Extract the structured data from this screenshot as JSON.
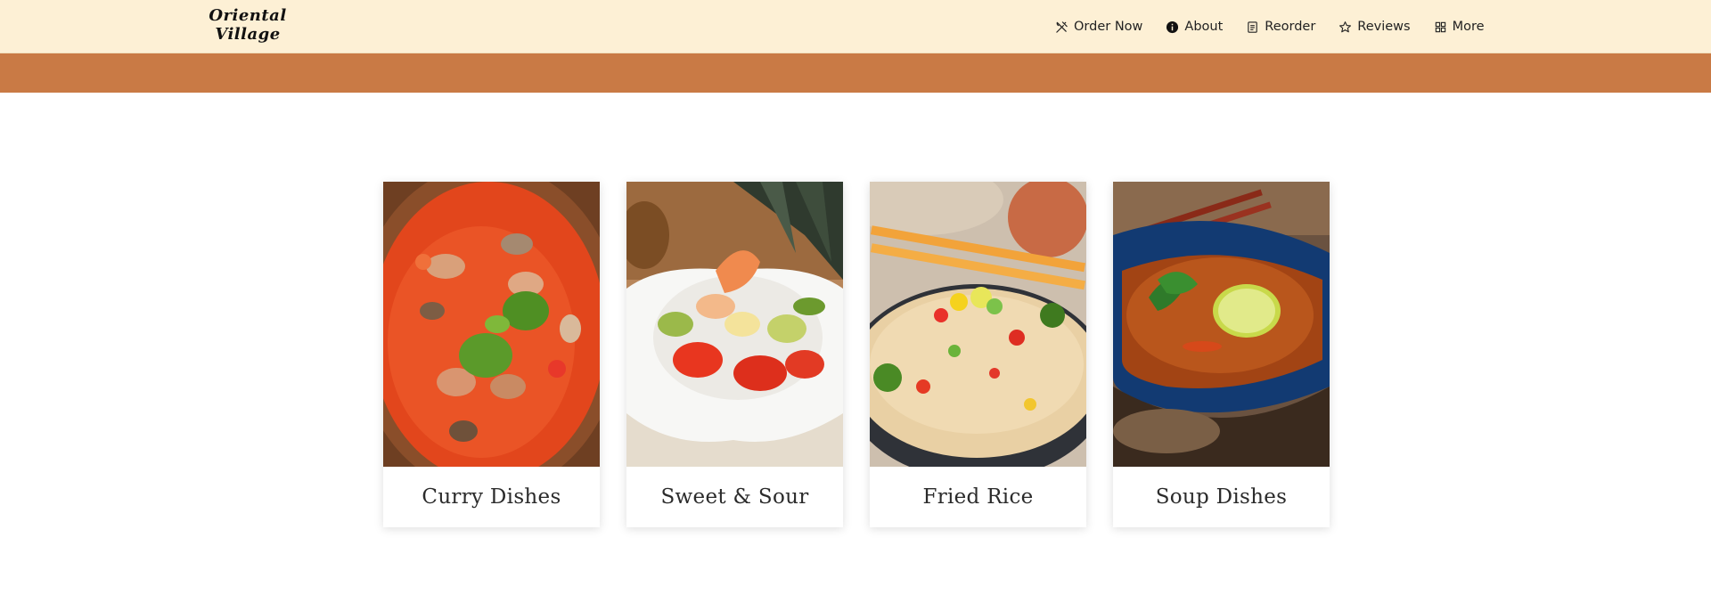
{
  "header": {
    "logo_line1": "Oriental",
    "logo_line2": "Village",
    "nav": [
      {
        "label": "Order Now",
        "icon": "utensils-icon"
      },
      {
        "label": "About",
        "icon": "info-icon"
      },
      {
        "label": "Reorder",
        "icon": "receipt-icon"
      },
      {
        "label": "Reviews",
        "icon": "star-icon"
      },
      {
        "label": "More",
        "icon": "grid-icon"
      }
    ]
  },
  "colors": {
    "header_bg": "#fdf0d5",
    "banner": "#c97a45",
    "text": "#222222"
  },
  "categories": [
    {
      "label": "Curry Dishes",
      "image": "curry-dish-photo"
    },
    {
      "label": "Sweet & Sour",
      "image": "sweet-sour-dish-photo"
    },
    {
      "label": "Fried Rice",
      "image": "fried-rice-photo"
    },
    {
      "label": "Soup Dishes",
      "image": "soup-dish-photo"
    }
  ]
}
